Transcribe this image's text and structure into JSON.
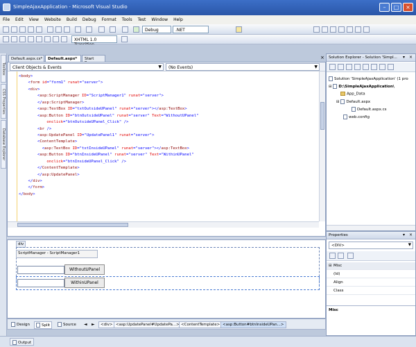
{
  "window": {
    "title": "SimpleAjaxApplication - Microsoft Visual Studio"
  },
  "menu": [
    "File",
    "Edit",
    "View",
    "Website",
    "Build",
    "Debug",
    "Format",
    "Tools",
    "Test",
    "Window",
    "Help"
  ],
  "toolbar": {
    "config": "Debug",
    "platform": ".NET",
    "doctype": "XHTML 1.0 Transition..."
  },
  "left_strip": {
    "toolbox": "Toolbox",
    "css": "CSS Properties",
    "dbexplorer": "Database Explorer"
  },
  "doc_tabs": [
    "Default.aspx.cs*",
    "Default.aspx*",
    "Start Page"
  ],
  "editor": {
    "left_dropdown": "Client Objects & Events",
    "right_dropdown": "(No Events)",
    "code_lines": [
      [
        {
          "c": "p",
          "t": "<"
        },
        {
          "c": "t",
          "t": "body"
        },
        {
          "c": "p",
          "t": ">"
        }
      ],
      [
        {
          "c": "x",
          "t": "    "
        },
        {
          "c": "p",
          "t": "<"
        },
        {
          "c": "t",
          "t": "form"
        },
        {
          "c": "x",
          "t": " "
        },
        {
          "c": "a",
          "t": "id"
        },
        {
          "c": "p",
          "t": "="
        },
        {
          "c": "v",
          "t": "\"form1\""
        },
        {
          "c": "x",
          "t": " "
        },
        {
          "c": "a",
          "t": "runat"
        },
        {
          "c": "p",
          "t": "="
        },
        {
          "c": "v",
          "t": "\"server\""
        },
        {
          "c": "p",
          "t": ">"
        }
      ],
      [
        {
          "c": "x",
          "t": "    "
        },
        {
          "c": "p",
          "t": "<"
        },
        {
          "c": "t",
          "t": "div"
        },
        {
          "c": "p",
          "t": ">"
        }
      ],
      [
        {
          "c": "x",
          "t": "        "
        },
        {
          "c": "p",
          "t": "<"
        },
        {
          "c": "t",
          "t": "asp:ScriptManager"
        },
        {
          "c": "x",
          "t": " "
        },
        {
          "c": "a",
          "t": "ID"
        },
        {
          "c": "p",
          "t": "="
        },
        {
          "c": "v",
          "t": "\"ScriptManager1\""
        },
        {
          "c": "x",
          "t": " "
        },
        {
          "c": "a",
          "t": "runat"
        },
        {
          "c": "p",
          "t": "="
        },
        {
          "c": "v",
          "t": "\"server\""
        },
        {
          "c": "p",
          "t": ">"
        }
      ],
      [
        {
          "c": "x",
          "t": "        "
        },
        {
          "c": "p",
          "t": "</"
        },
        {
          "c": "t",
          "t": "asp:ScriptManager"
        },
        {
          "c": "p",
          "t": ">"
        }
      ],
      [
        {
          "c": "x",
          "t": "        "
        },
        {
          "c": "p",
          "t": "<"
        },
        {
          "c": "t",
          "t": "asp:TextBox"
        },
        {
          "c": "x",
          "t": " "
        },
        {
          "c": "a",
          "t": "ID"
        },
        {
          "c": "p",
          "t": "="
        },
        {
          "c": "v",
          "t": "\"txtOutsideUPanel\""
        },
        {
          "c": "x",
          "t": " "
        },
        {
          "c": "a",
          "t": "runat"
        },
        {
          "c": "p",
          "t": "="
        },
        {
          "c": "v",
          "t": "\"server\""
        },
        {
          "c": "p",
          "t": "></"
        },
        {
          "c": "t",
          "t": "asp:TextBox"
        },
        {
          "c": "p",
          "t": ">"
        }
      ],
      [
        {
          "c": "x",
          "t": "        "
        },
        {
          "c": "p",
          "t": "<"
        },
        {
          "c": "t",
          "t": "asp:Button"
        },
        {
          "c": "x",
          "t": " "
        },
        {
          "c": "a",
          "t": "ID"
        },
        {
          "c": "p",
          "t": "="
        },
        {
          "c": "v",
          "t": "\"btnOutsideUPanel\""
        },
        {
          "c": "x",
          "t": " "
        },
        {
          "c": "a",
          "t": "runat"
        },
        {
          "c": "p",
          "t": "="
        },
        {
          "c": "v",
          "t": "\"server\""
        },
        {
          "c": "x",
          "t": " "
        },
        {
          "c": "a",
          "t": "Text"
        },
        {
          "c": "p",
          "t": "="
        },
        {
          "c": "v",
          "t": "\"WithoutUPanel\""
        }
      ],
      [
        {
          "c": "x",
          "t": "            "
        },
        {
          "c": "a",
          "t": "onclick"
        },
        {
          "c": "p",
          "t": "="
        },
        {
          "c": "v",
          "t": "\"btnOutsideUPanel_Click\""
        },
        {
          "c": "x",
          "t": " "
        },
        {
          "c": "p",
          "t": "/>"
        }
      ],
      [
        {
          "c": "x",
          "t": "        "
        },
        {
          "c": "p",
          "t": "<"
        },
        {
          "c": "t",
          "t": "br"
        },
        {
          "c": "x",
          "t": " "
        },
        {
          "c": "p",
          "t": "/>"
        }
      ],
      [
        {
          "c": "x",
          "t": "        "
        },
        {
          "c": "p",
          "t": "<"
        },
        {
          "c": "t",
          "t": "asp:UpdatePanel"
        },
        {
          "c": "x",
          "t": " "
        },
        {
          "c": "a",
          "t": "ID"
        },
        {
          "c": "p",
          "t": "="
        },
        {
          "c": "v",
          "t": "\"UpdatePanel1\""
        },
        {
          "c": "x",
          "t": " "
        },
        {
          "c": "a",
          "t": "runat"
        },
        {
          "c": "p",
          "t": "="
        },
        {
          "c": "v",
          "t": "\"server\""
        },
        {
          "c": "p",
          "t": ">"
        }
      ],
      [
        {
          "c": "x",
          "t": "        "
        },
        {
          "c": "p",
          "t": "<"
        },
        {
          "c": "t",
          "t": "ContentTemplate"
        },
        {
          "c": "p",
          "t": ">"
        }
      ],
      [
        {
          "c": "x",
          "t": "          "
        },
        {
          "c": "p",
          "t": "<"
        },
        {
          "c": "t",
          "t": "asp:TextBox"
        },
        {
          "c": "x",
          "t": " "
        },
        {
          "c": "a",
          "t": "ID"
        },
        {
          "c": "p",
          "t": "="
        },
        {
          "c": "v",
          "t": "\"txtInsideUPanel\""
        },
        {
          "c": "x",
          "t": " "
        },
        {
          "c": "a",
          "t": "runat"
        },
        {
          "c": "p",
          "t": "="
        },
        {
          "c": "v",
          "t": "\"server\""
        },
        {
          "c": "p",
          "t": "></"
        },
        {
          "c": "t",
          "t": "asp:TextBox"
        },
        {
          "c": "p",
          "t": ">"
        }
      ],
      [
        {
          "c": "x",
          "t": "        "
        },
        {
          "c": "p",
          "t": "<"
        },
        {
          "c": "t",
          "t": "asp:Button"
        },
        {
          "c": "x",
          "t": " "
        },
        {
          "c": "a",
          "t": "ID"
        },
        {
          "c": "p",
          "t": "="
        },
        {
          "c": "v",
          "t": "\"btnInsideUPanel\""
        },
        {
          "c": "x",
          "t": " "
        },
        {
          "c": "a",
          "t": "runat"
        },
        {
          "c": "p",
          "t": "="
        },
        {
          "c": "v",
          "t": "\"server\""
        },
        {
          "c": "x",
          "t": " "
        },
        {
          "c": "a",
          "t": "Text"
        },
        {
          "c": "p",
          "t": "="
        },
        {
          "c": "v",
          "t": "\"WithinUPanel\""
        }
      ],
      [
        {
          "c": "x",
          "t": "            "
        },
        {
          "c": "a",
          "t": "onclick"
        },
        {
          "c": "p",
          "t": "="
        },
        {
          "c": "v",
          "t": "\"btnInsideUPanel_Click\""
        },
        {
          "c": "x",
          "t": " "
        },
        {
          "c": "p",
          "t": "/>"
        }
      ],
      [
        {
          "c": "x",
          "t": "        "
        },
        {
          "c": "p",
          "t": "</"
        },
        {
          "c": "t",
          "t": "ContentTemplate"
        },
        {
          "c": "p",
          "t": ">"
        }
      ],
      [
        {
          "c": "x",
          "t": "        "
        },
        {
          "c": "p",
          "t": "</"
        },
        {
          "c": "t",
          "t": "asp:UpdatePanel"
        },
        {
          "c": "p",
          "t": ">"
        }
      ],
      [
        {
          "c": "x",
          "t": "    "
        },
        {
          "c": "p",
          "t": "</"
        },
        {
          "c": "t",
          "t": "div"
        },
        {
          "c": "p",
          "t": ">"
        }
      ],
      [
        {
          "c": "x",
          "t": "    "
        },
        {
          "c": "p",
          "t": "</"
        },
        {
          "c": "t",
          "t": "form"
        },
        {
          "c": "p",
          "t": ">"
        }
      ],
      [
        {
          "c": "p",
          "t": "</"
        },
        {
          "c": "t",
          "t": "body"
        },
        {
          "c": "p",
          "t": ">"
        }
      ]
    ]
  },
  "design": {
    "div_label": "div",
    "sm_label": "ScriptManager - ScriptManager1",
    "btn_outside": "WithoutUPanel",
    "btn_inside": "WithinUPanel"
  },
  "bottom": {
    "design": "Design",
    "split": "Split",
    "source": "Source",
    "crumbs": [
      "<div>",
      "<asp:UpdatePanel#UpdatePa...>",
      "<ContentTemplate>",
      "<asp:Button#btnInsideUPan...>"
    ]
  },
  "solution": {
    "title": "Solution Explorer - Solution 'Simpl...",
    "items": [
      "Solution 'SimpleAjaxApplication' (1 pro",
      "D:\\SimpleAjaxApplication\\",
      "App_Data",
      "Default.aspx",
      "Default.aspx.cs",
      "web.config"
    ]
  },
  "properties": {
    "title": "Properties",
    "selector": "<DIV>",
    "rows": [
      "Misc",
      "(Id)",
      "Align",
      "Class"
    ],
    "footer": "Misc"
  },
  "status": {
    "output": "Output"
  }
}
